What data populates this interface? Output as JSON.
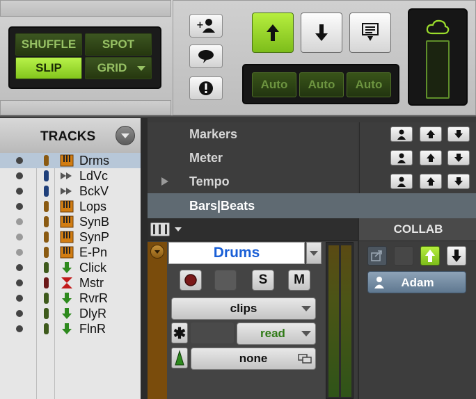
{
  "edit_modes": {
    "shuffle": "SHUFFLE",
    "spot": "SPOT",
    "slip": "SLIP",
    "grid": "GRID"
  },
  "auto_buttons": [
    "Auto",
    "Auto",
    "Auto"
  ],
  "tracks_panel": {
    "title": "TRACKS",
    "items": [
      {
        "name": "Drms",
        "type_icon": "instrument-icon",
        "color": "#8a5a12",
        "selected": true
      },
      {
        "name": "LdVc",
        "type_icon": "audio-icon",
        "color": "#1f3f7a",
        "selected": false
      },
      {
        "name": "BckV",
        "type_icon": "audio-icon",
        "color": "#1f3f7a",
        "selected": false
      },
      {
        "name": "Lops",
        "type_icon": "instrument-icon",
        "color": "#8a5a12",
        "selected": false
      },
      {
        "name": "SynB",
        "type_icon": "instrument-icon",
        "color": "#8a5a12",
        "selected": false
      },
      {
        "name": "SynP",
        "type_icon": "instrument-icon",
        "color": "#8a5a12",
        "selected": false
      },
      {
        "name": "E-Pn",
        "type_icon": "instrument-icon",
        "color": "#8a5a12",
        "selected": false
      },
      {
        "name": "Click",
        "type_icon": "aux-input-icon",
        "color": "#3e5a1c",
        "selected": false
      },
      {
        "name": "Mstr",
        "type_icon": "master-fader-icon",
        "color": "#6b1818",
        "selected": false
      },
      {
        "name": "RvrR",
        "type_icon": "aux-input-icon",
        "color": "#3e5a1c",
        "selected": false
      },
      {
        "name": "DlyR",
        "type_icon": "aux-input-icon",
        "color": "#3e5a1c",
        "selected": false
      },
      {
        "name": "FlnR",
        "type_icon": "aux-input-icon",
        "color": "#3e5a1c",
        "selected": false
      }
    ]
  },
  "rulers": [
    {
      "label": "Markers",
      "has_arrow": false
    },
    {
      "label": "Meter",
      "has_arrow": false
    },
    {
      "label": "Tempo",
      "has_arrow": true
    },
    {
      "label": "Bars|Beats",
      "has_arrow": false
    }
  ],
  "collab": {
    "title": "COLLAB",
    "user": "Adam"
  },
  "track_edit": {
    "name": "Drums",
    "solo_label": "S",
    "mute_label": "M",
    "view_mode": "clips",
    "automation_mode": "read",
    "group": "none",
    "name_color": "#1a5fd6",
    "auto_color": "#2f7a16"
  },
  "colors": {
    "lcd_green": "#97c164",
    "active_green": "#9bdc2c"
  }
}
